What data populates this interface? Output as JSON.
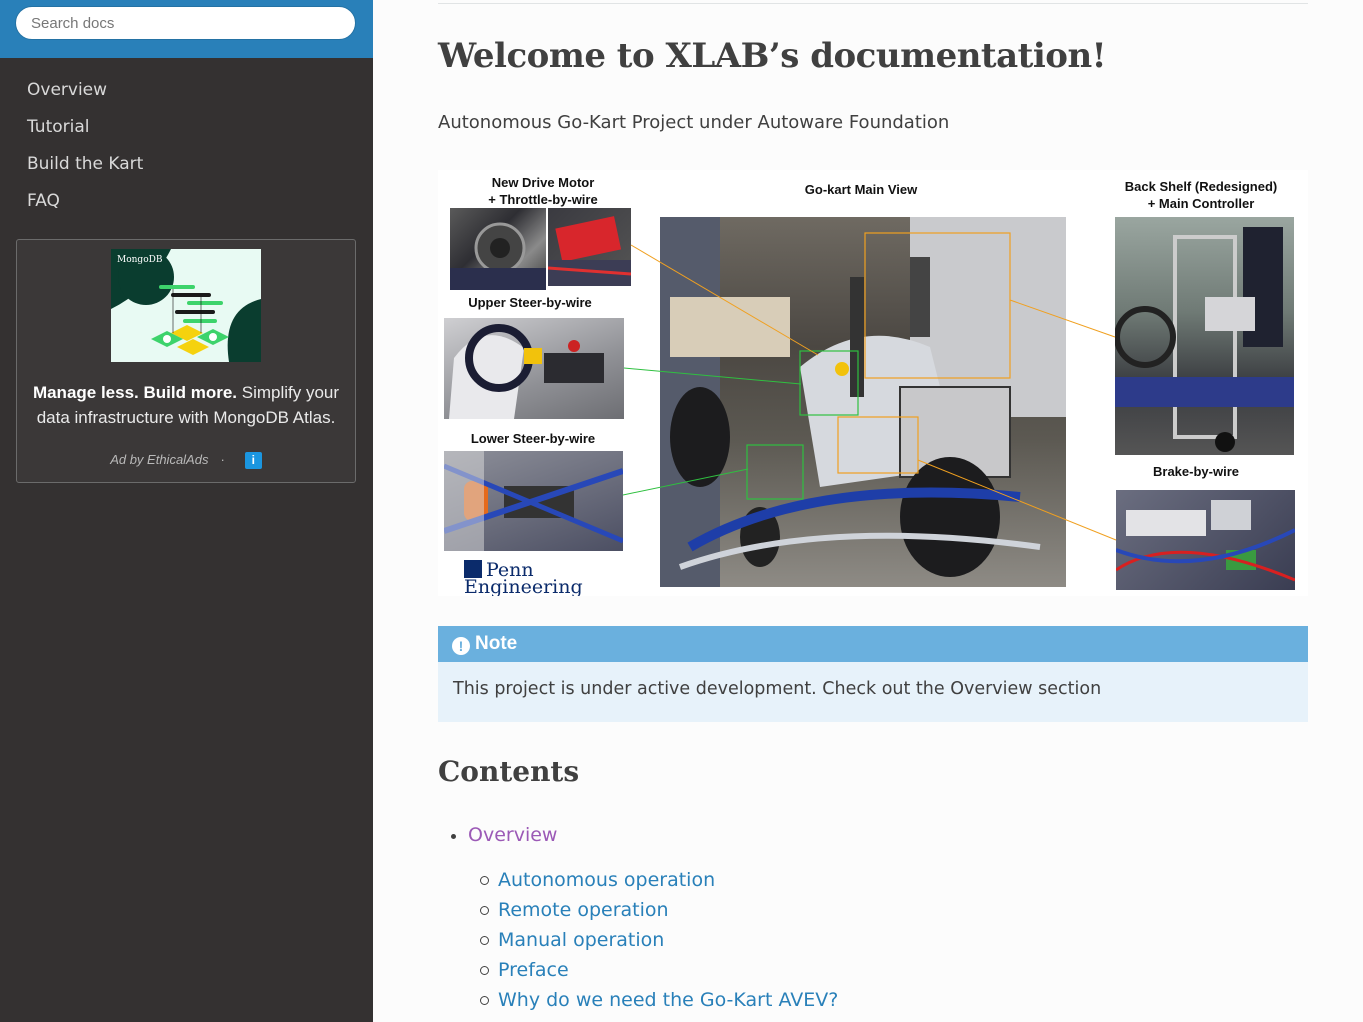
{
  "sidebar": {
    "search_placeholder": "Search docs",
    "nav": [
      "Overview",
      "Tutorial",
      "Build the Kart",
      "FAQ"
    ],
    "ad": {
      "brand": "MongoDB",
      "headline": "Manage less. Build more.",
      "body": "Simplify your data infrastructure with MongoDB Atlas.",
      "footer": "Ad by EthicalAds",
      "info_glyph": "i"
    }
  },
  "main": {
    "title": "Welcome to XLAB’s documentation!",
    "subtitle": "Autonomous Go-Kart Project under Autoware Foundation",
    "figure": {
      "label_drive_1": "New Drive Motor",
      "label_drive_2": "+ Throttle-by-wire",
      "label_upper": "Upper Steer-by-wire",
      "label_lower": "Lower Steer-by-wire",
      "label_main": "Go-kart Main View",
      "label_shelf_1": "Back Shelf (Redesigned)",
      "label_shelf_2": "+ Main Controller",
      "label_brake": "Brake-by-wire",
      "logo": "Penn Engineering"
    },
    "note": {
      "title": "Note",
      "body": "This project is under active development. Check out the Overview section"
    },
    "contents_title": "Contents",
    "toc": {
      "top": "Overview",
      "sub": [
        "Autonomous operation",
        "Remote operation",
        "Manual operation",
        "Preface",
        "Why do we need the Go-Kart AVEV?"
      ]
    }
  },
  "colors": {
    "sidebar_bg": "#343131",
    "search_band": "#2980b9",
    "note_header": "#6ab0de",
    "note_bg": "#e7f2fa",
    "link": "#2980b9",
    "visited_link": "#9b59b6"
  }
}
